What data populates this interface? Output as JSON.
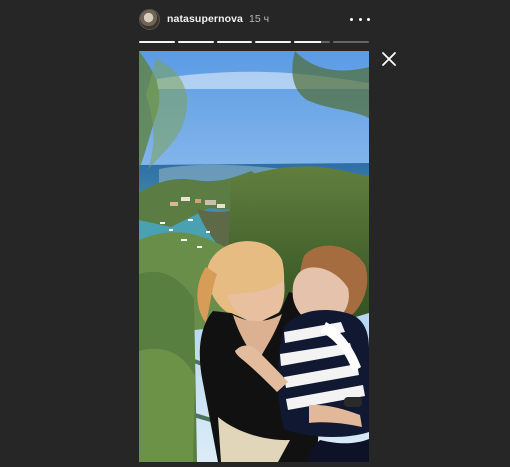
{
  "story": {
    "username": "natasupernova",
    "time_ago": "15 ч",
    "progress_segments": [
      1,
      1,
      1,
      1,
      0.75,
      0
    ],
    "colors": {
      "background": "#262626",
      "text": "#f2f2f2",
      "progress_track": "#666666",
      "progress_fill": "#f5f5f5"
    }
  },
  "icons": {
    "avatar": "profile-avatar",
    "more": "more-horizontal-icon",
    "close": "close-icon"
  }
}
